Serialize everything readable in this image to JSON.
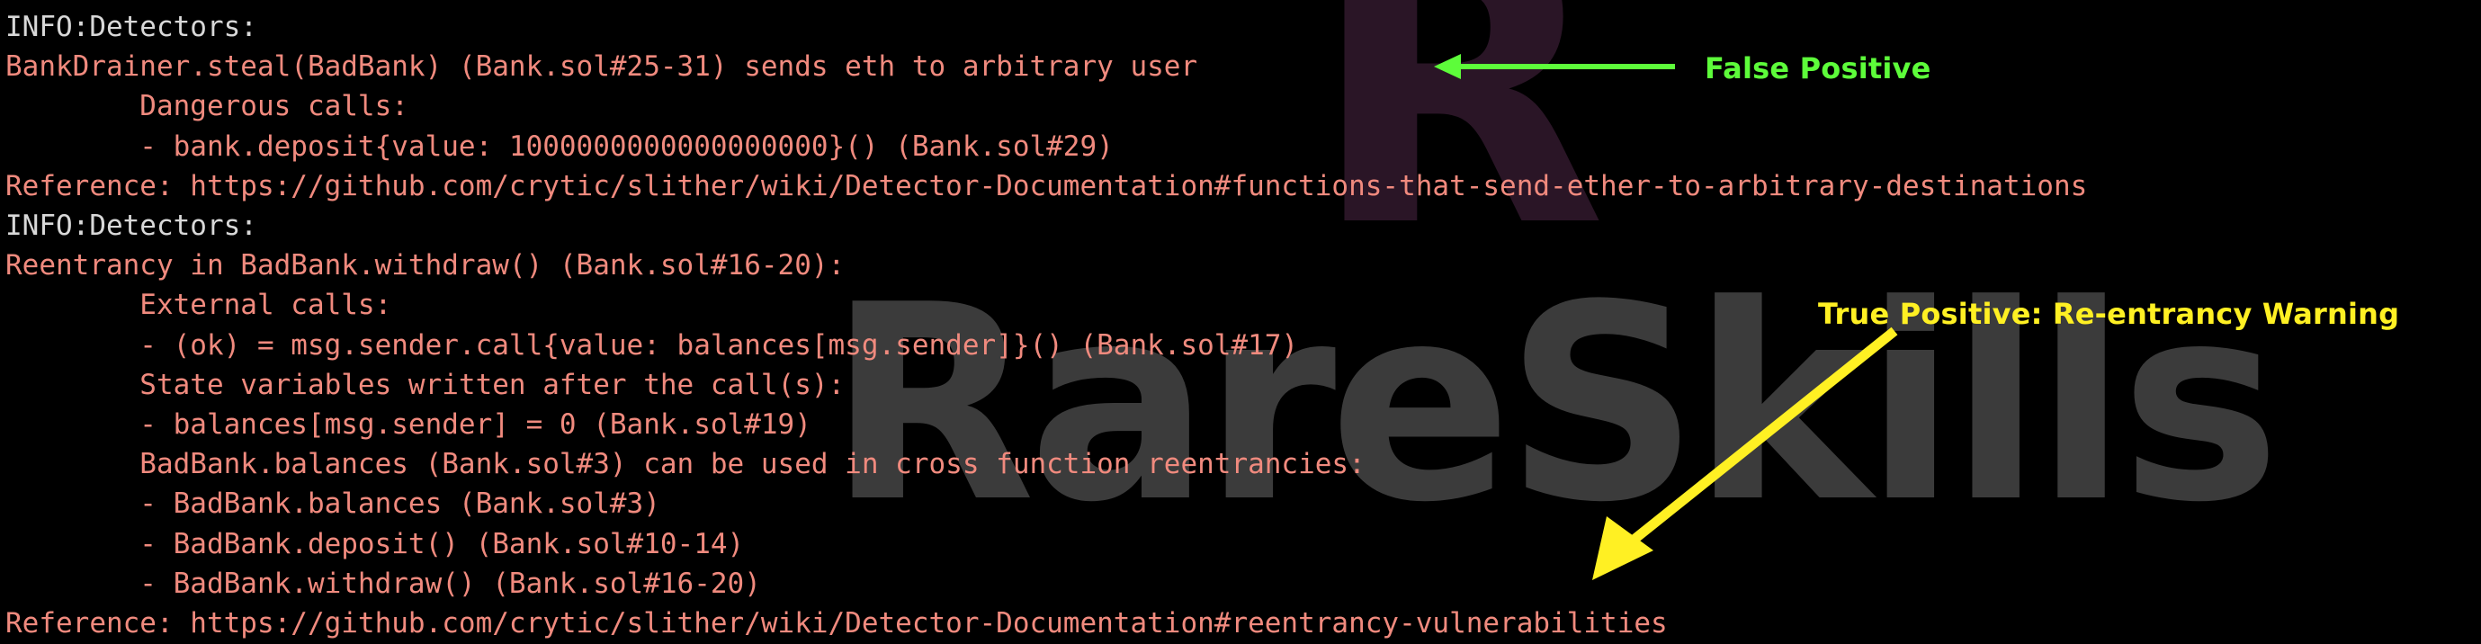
{
  "terminal": {
    "background_color": "#000000",
    "text_color": "#f08a7e",
    "info_color": "#d8d8d8",
    "lines": [
      {
        "text": "INFO:Detectors:",
        "style": "info"
      },
      {
        "text": "BankDrainer.steal(BadBank) (Bank.sol#25-31) sends eth to arbitrary user",
        "style": "red"
      },
      {
        "text": "        Dangerous calls:",
        "style": "red"
      },
      {
        "text": "        - bank.deposit{value: 1000000000000000000}() (Bank.sol#29)",
        "style": "red"
      },
      {
        "text": "Reference: https://github.com/crytic/slither/wiki/Detector-Documentation#functions-that-send-ether-to-arbitrary-destinations",
        "style": "red"
      },
      {
        "text": "INFO:Detectors:",
        "style": "info"
      },
      {
        "text": "Reentrancy in BadBank.withdraw() (Bank.sol#16-20):",
        "style": "red"
      },
      {
        "text": "        External calls:",
        "style": "red"
      },
      {
        "text": "        - (ok) = msg.sender.call{value: balances[msg.sender]}() (Bank.sol#17)",
        "style": "red"
      },
      {
        "text": "        State variables written after the call(s):",
        "style": "red"
      },
      {
        "text": "        - balances[msg.sender] = 0 (Bank.sol#19)",
        "style": "red"
      },
      {
        "text": "        BadBank.balances (Bank.sol#3) can be used in cross function reentrancies:",
        "style": "red"
      },
      {
        "text": "        - BadBank.balances (Bank.sol#3)",
        "style": "red"
      },
      {
        "text": "        - BadBank.deposit() (Bank.sol#10-14)",
        "style": "red"
      },
      {
        "text": "        - BadBank.withdraw() (Bank.sol#16-20)",
        "style": "red"
      },
      {
        "text": "Reference: https://github.com/crytic/slither/wiki/Detector-Documentation#reentrancy-vulnerabilities",
        "style": "red"
      }
    ]
  },
  "annotations": {
    "false_positive": {
      "label": "False Positive",
      "color": "#5dfc3a",
      "arrow": "left-arrow"
    },
    "true_positive": {
      "label": "True Positive: Re-entrancy Warning",
      "color": "#fff023",
      "arrow": "down-left-arrow"
    }
  },
  "watermark": {
    "logo_glyph": "R",
    "brand_text": "RareSkills",
    "logo_color": "#2a1526",
    "brand_color": "#3b3b3b"
  }
}
